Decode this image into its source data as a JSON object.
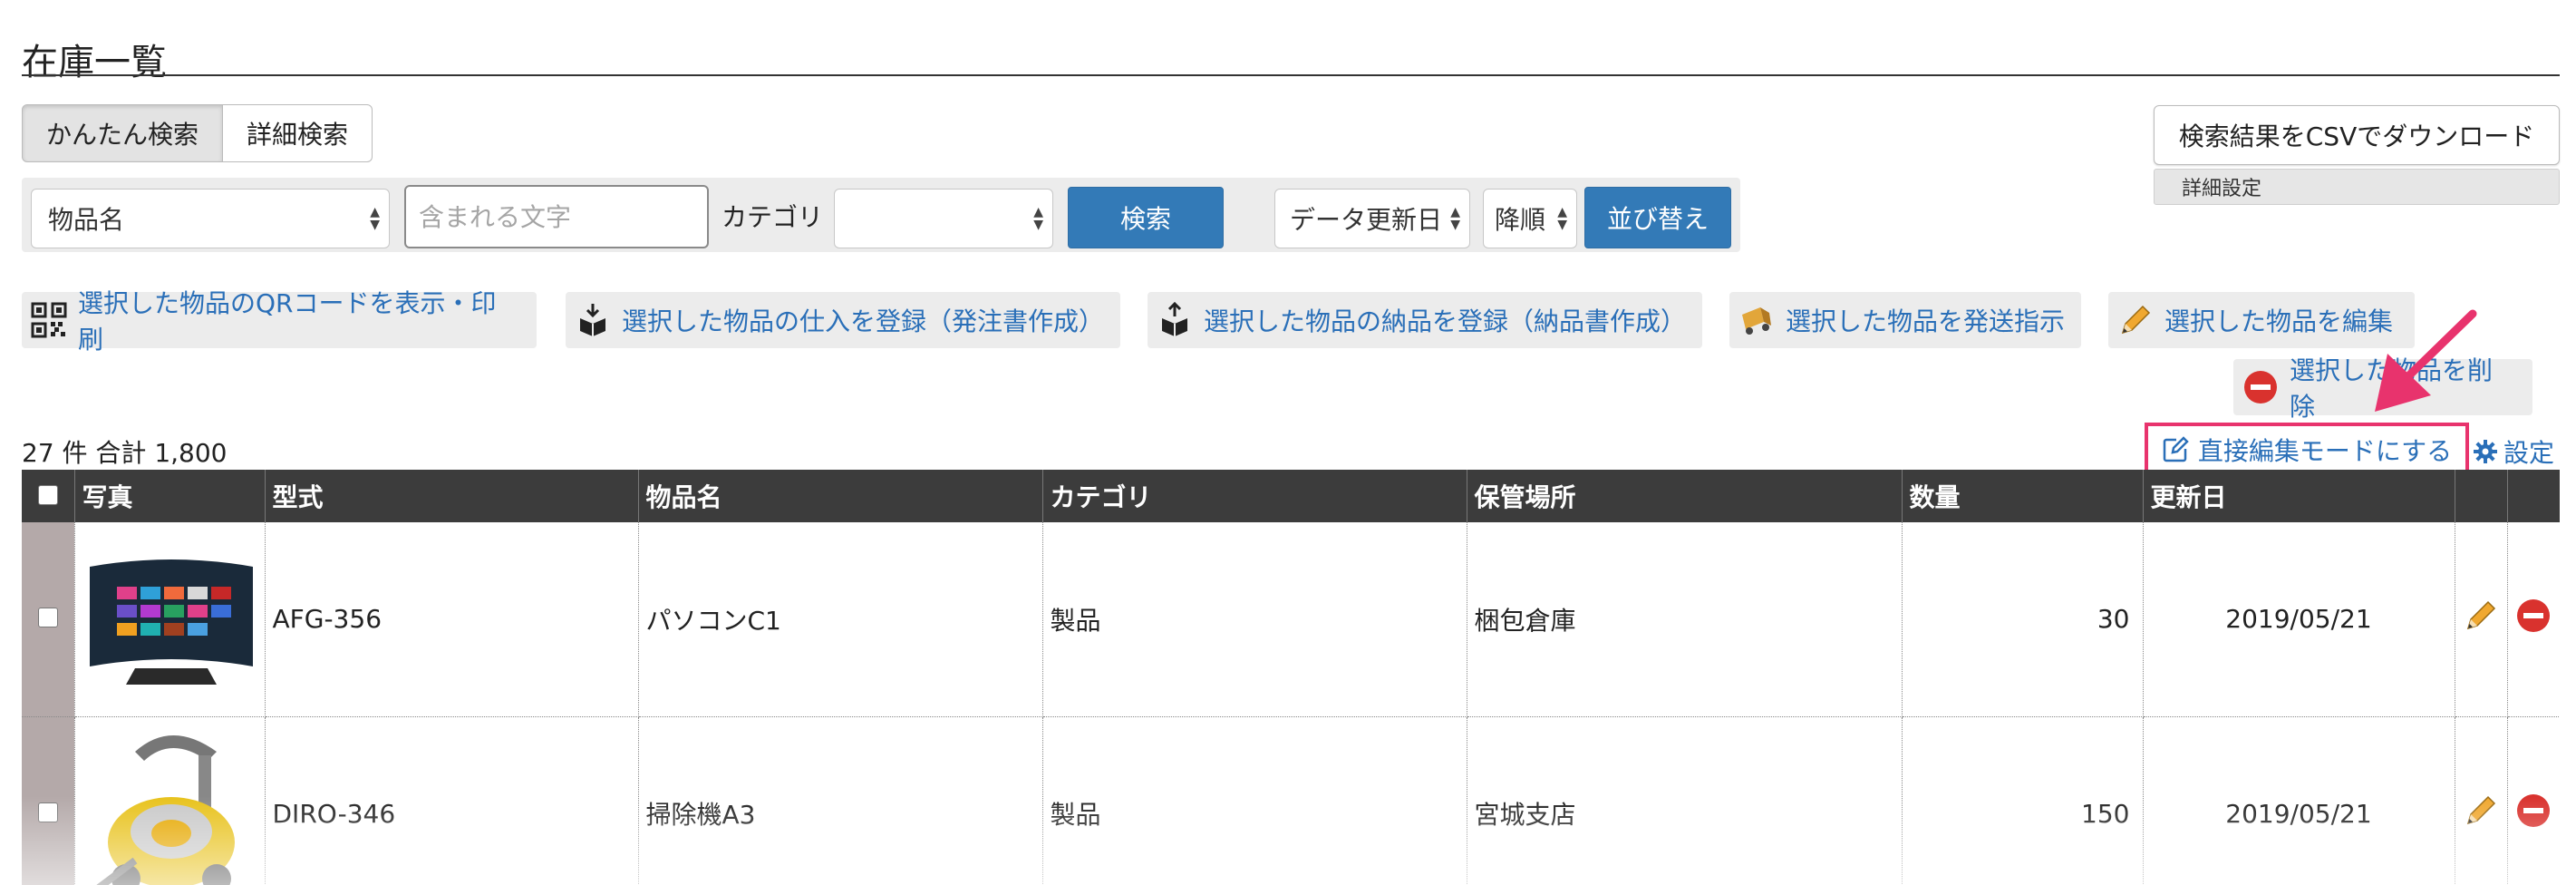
{
  "page": {
    "title": "在庫一覧"
  },
  "search_tabs": [
    {
      "label": "かんたん検索",
      "active": true
    },
    {
      "label": "詳細検索",
      "active": false
    }
  ],
  "filter": {
    "field_select": "物品名",
    "text_placeholder": "含まれる文字",
    "category_label": "カテゴリ",
    "category_select": "",
    "search_button": "検索",
    "sort_field_select": "データ更新日",
    "sort_order_select": "降順",
    "sort_button": "並び替え"
  },
  "right_actions": {
    "csv_download": "検索結果をCSVでダウンロード",
    "detail_settings": "詳細設定"
  },
  "bulk_actions": [
    {
      "label": "選択した物品のQRコードを表示・印刷",
      "icon": "qr-code-icon"
    },
    {
      "label": "選択した物品の仕入を登録（発注書作成）",
      "icon": "box-in-icon"
    },
    {
      "label": "選択した物品の納品を登録（納品書作成）",
      "icon": "box-out-icon"
    },
    {
      "label": "選択した物品を発送指示",
      "icon": "truck-icon"
    },
    {
      "label": "選択した物品を編集",
      "icon": "pencil-icon"
    },
    {
      "label": "選択した物品を削除",
      "icon": "delete-icon"
    }
  ],
  "summary": {
    "count_text": "27 件 合計 1,800"
  },
  "links": {
    "direct_edit": "直接編集モードにする",
    "settings": "設定"
  },
  "colors": {
    "link": "#2a6fb8",
    "primary": "#337ab7",
    "highlight": "#e8336d",
    "header_bg": "#3c3c3c"
  },
  "table": {
    "headers": {
      "photo": "写真",
      "model": "型式",
      "name": "物品名",
      "category": "カテゴリ",
      "location": "保管場所",
      "quantity": "数量",
      "updated": "更新日"
    },
    "rows": [
      {
        "model": "AFG-356",
        "name": "パソコンC1",
        "category": "製品",
        "location": "梱包倉庫",
        "quantity": "30",
        "updated": "2019/05/21",
        "photo": "tv-photo"
      },
      {
        "model": "DIRO-346",
        "name": "掃除機A3",
        "category": "製品",
        "location": "宮城支店",
        "quantity": "150",
        "updated": "2019/05/21",
        "photo": "vacuum-photo"
      }
    ]
  }
}
